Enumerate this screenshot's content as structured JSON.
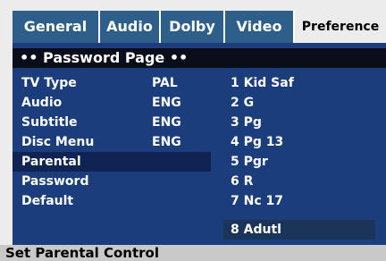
{
  "tabs": [
    {
      "label": "General",
      "active": false
    },
    {
      "label": "Audio",
      "active": false
    },
    {
      "label": "Dolby",
      "active": false
    },
    {
      "label": "Video",
      "active": false
    },
    {
      "label": "Preference",
      "active": true
    }
  ],
  "page_title": "•• Password Page ••",
  "settings": [
    {
      "label": "TV Type",
      "value": "PAL"
    },
    {
      "label": "Audio",
      "value": "ENG"
    },
    {
      "label": "Subtitle",
      "value": "ENG"
    },
    {
      "label": "Disc Menu",
      "value": "ENG"
    },
    {
      "label": "Parental",
      "value": "",
      "selected": true
    },
    {
      "label": "Password",
      "value": ""
    },
    {
      "label": "Default",
      "value": ""
    }
  ],
  "parental_options": [
    {
      "label": "1 Kid Saf"
    },
    {
      "label": "2 G"
    },
    {
      "label": "3 Pg"
    },
    {
      "label": "4 Pg 13"
    },
    {
      "label": "5 Pgr"
    },
    {
      "label": "6 R"
    },
    {
      "label": "7 Nc 17"
    },
    {
      "label": "8 Adutl",
      "highlighted": true
    }
  ],
  "status_text": "Set Parental Control",
  "colors": {
    "panel_bg": "#1b3d7b",
    "tab_bg": "#2e5f8a",
    "title_bg": "#0b0e1a",
    "selected_row": "#0f2452",
    "highlighted_option": "#1b345a",
    "status_bg": "#c9c9c9"
  }
}
